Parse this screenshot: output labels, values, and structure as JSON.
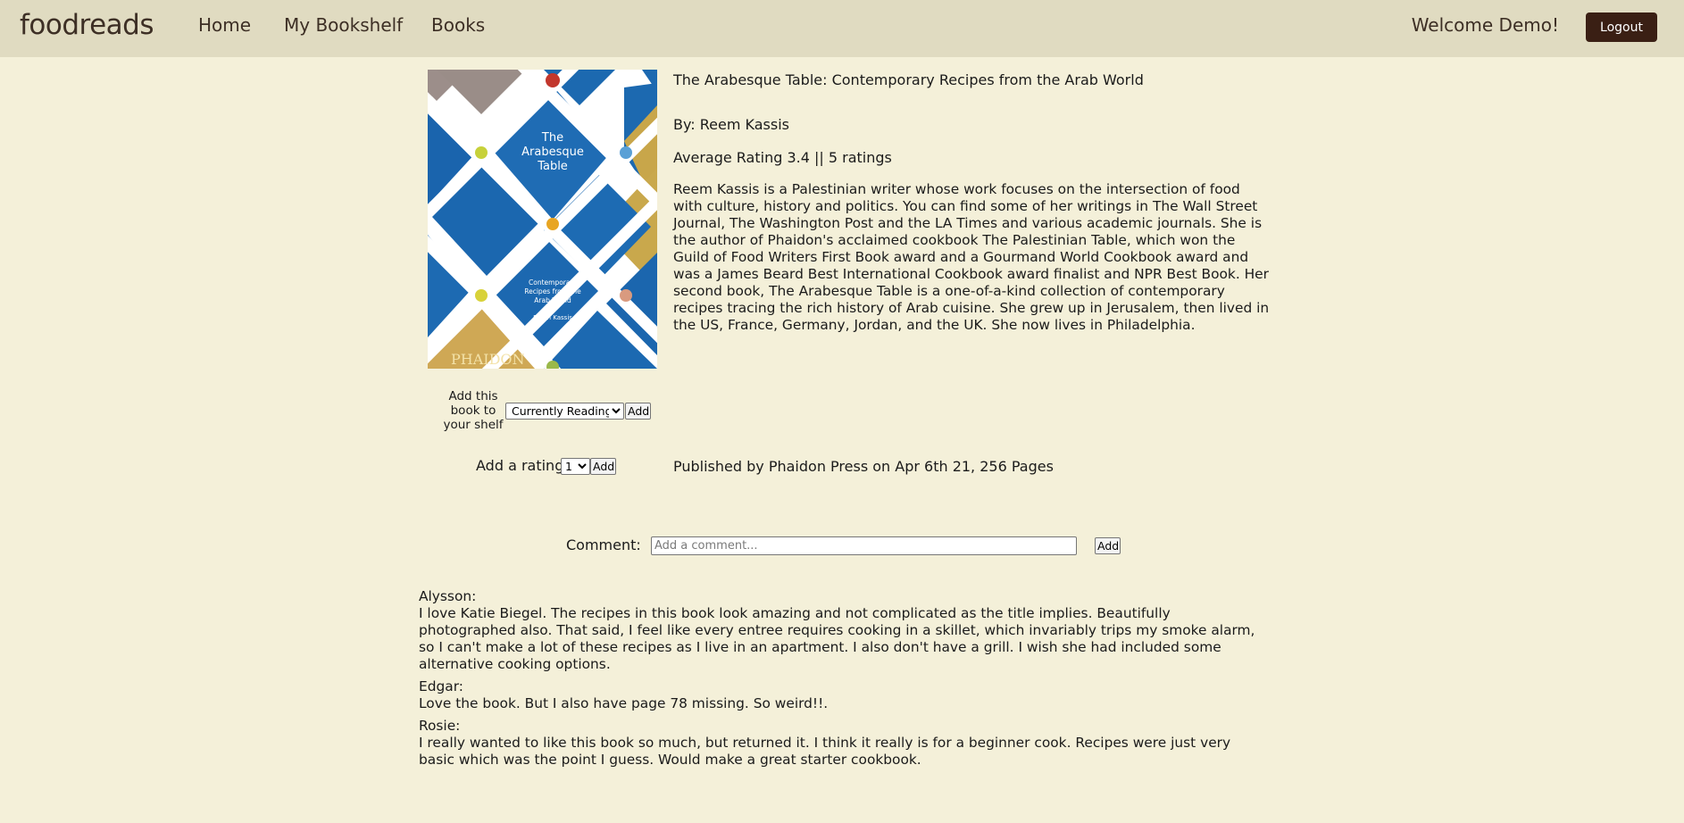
{
  "nav": {
    "brand": "foodreads",
    "links": [
      "Home",
      "My Bookshelf",
      "Books"
    ],
    "welcome": "Welcome Demo!",
    "logout_label": "Logout"
  },
  "cover": {
    "title_lines": [
      "The",
      "Arabesque",
      "Table"
    ],
    "subtitle_lines": [
      "Contemporary",
      "Recipes from the",
      "Arab World"
    ],
    "author": "Reem Kassis",
    "publisher": "PHAIDON"
  },
  "book": {
    "title": "The Arabesque Table: Contemporary Recipes from the Arab World",
    "author": "By: Reem Kassis",
    "rating": "Average Rating 3.4 || 5 ratings",
    "description": "Reem Kassis is a Palestinian writer whose work focuses on the intersection of food with culture, history and politics. You can find some of her writings in The Wall Street Journal, The Washington Post and the LA Times and various academic journals. She is the author of Phaidon's acclaimed cookbook The Palestinian Table, which won the Guild of Food Writers First Book award and a Gourmand World Cookbook award and was a James Beard Best International Cookbook award finalist and NPR Best Book. Her second book, The Arabesque Table is a one-of-a-kind collection of contemporary recipes tracing the rich history of Arab cuisine. She grew up in Jerusalem, then lived in the US, France, Germany, Jordan, and the UK. She now lives in Philadelphia.",
    "published": "Published by Phaidon Press on Apr 6th 21, 256 Pages"
  },
  "shelf": {
    "label": "Add this book to your shelf",
    "selected": "Currently Reading",
    "add_label": "Add"
  },
  "rating_form": {
    "label": "Add a rating",
    "selected": "1",
    "add_label": "Add"
  },
  "comment_form": {
    "label": "Comment:",
    "placeholder": "Add a comment...",
    "add_label": "Add"
  },
  "comments": [
    {
      "author": "Alysson:",
      "text": "I love Katie Biegel. The recipes in this book look amazing and not complicated as the title implies. Beautifully photographed also. That said, I feel like every entree requires cooking in a skillet, which invariably trips my smoke alarm, so I can't make a lot of these recipes as I live in an apartment. I also don't have a grill. I wish she had included some alternative cooking options."
    },
    {
      "author": "Edgar:",
      "text": "Love the book. But I also have page 78 missing. So weird!!."
    },
    {
      "author": "Rosie:",
      "text": "I really wanted to like this book so much, but returned it. I think it really is for a beginner cook. Recipes were just very basic which was the point I guess. Would make a great starter cookbook."
    }
  ]
}
